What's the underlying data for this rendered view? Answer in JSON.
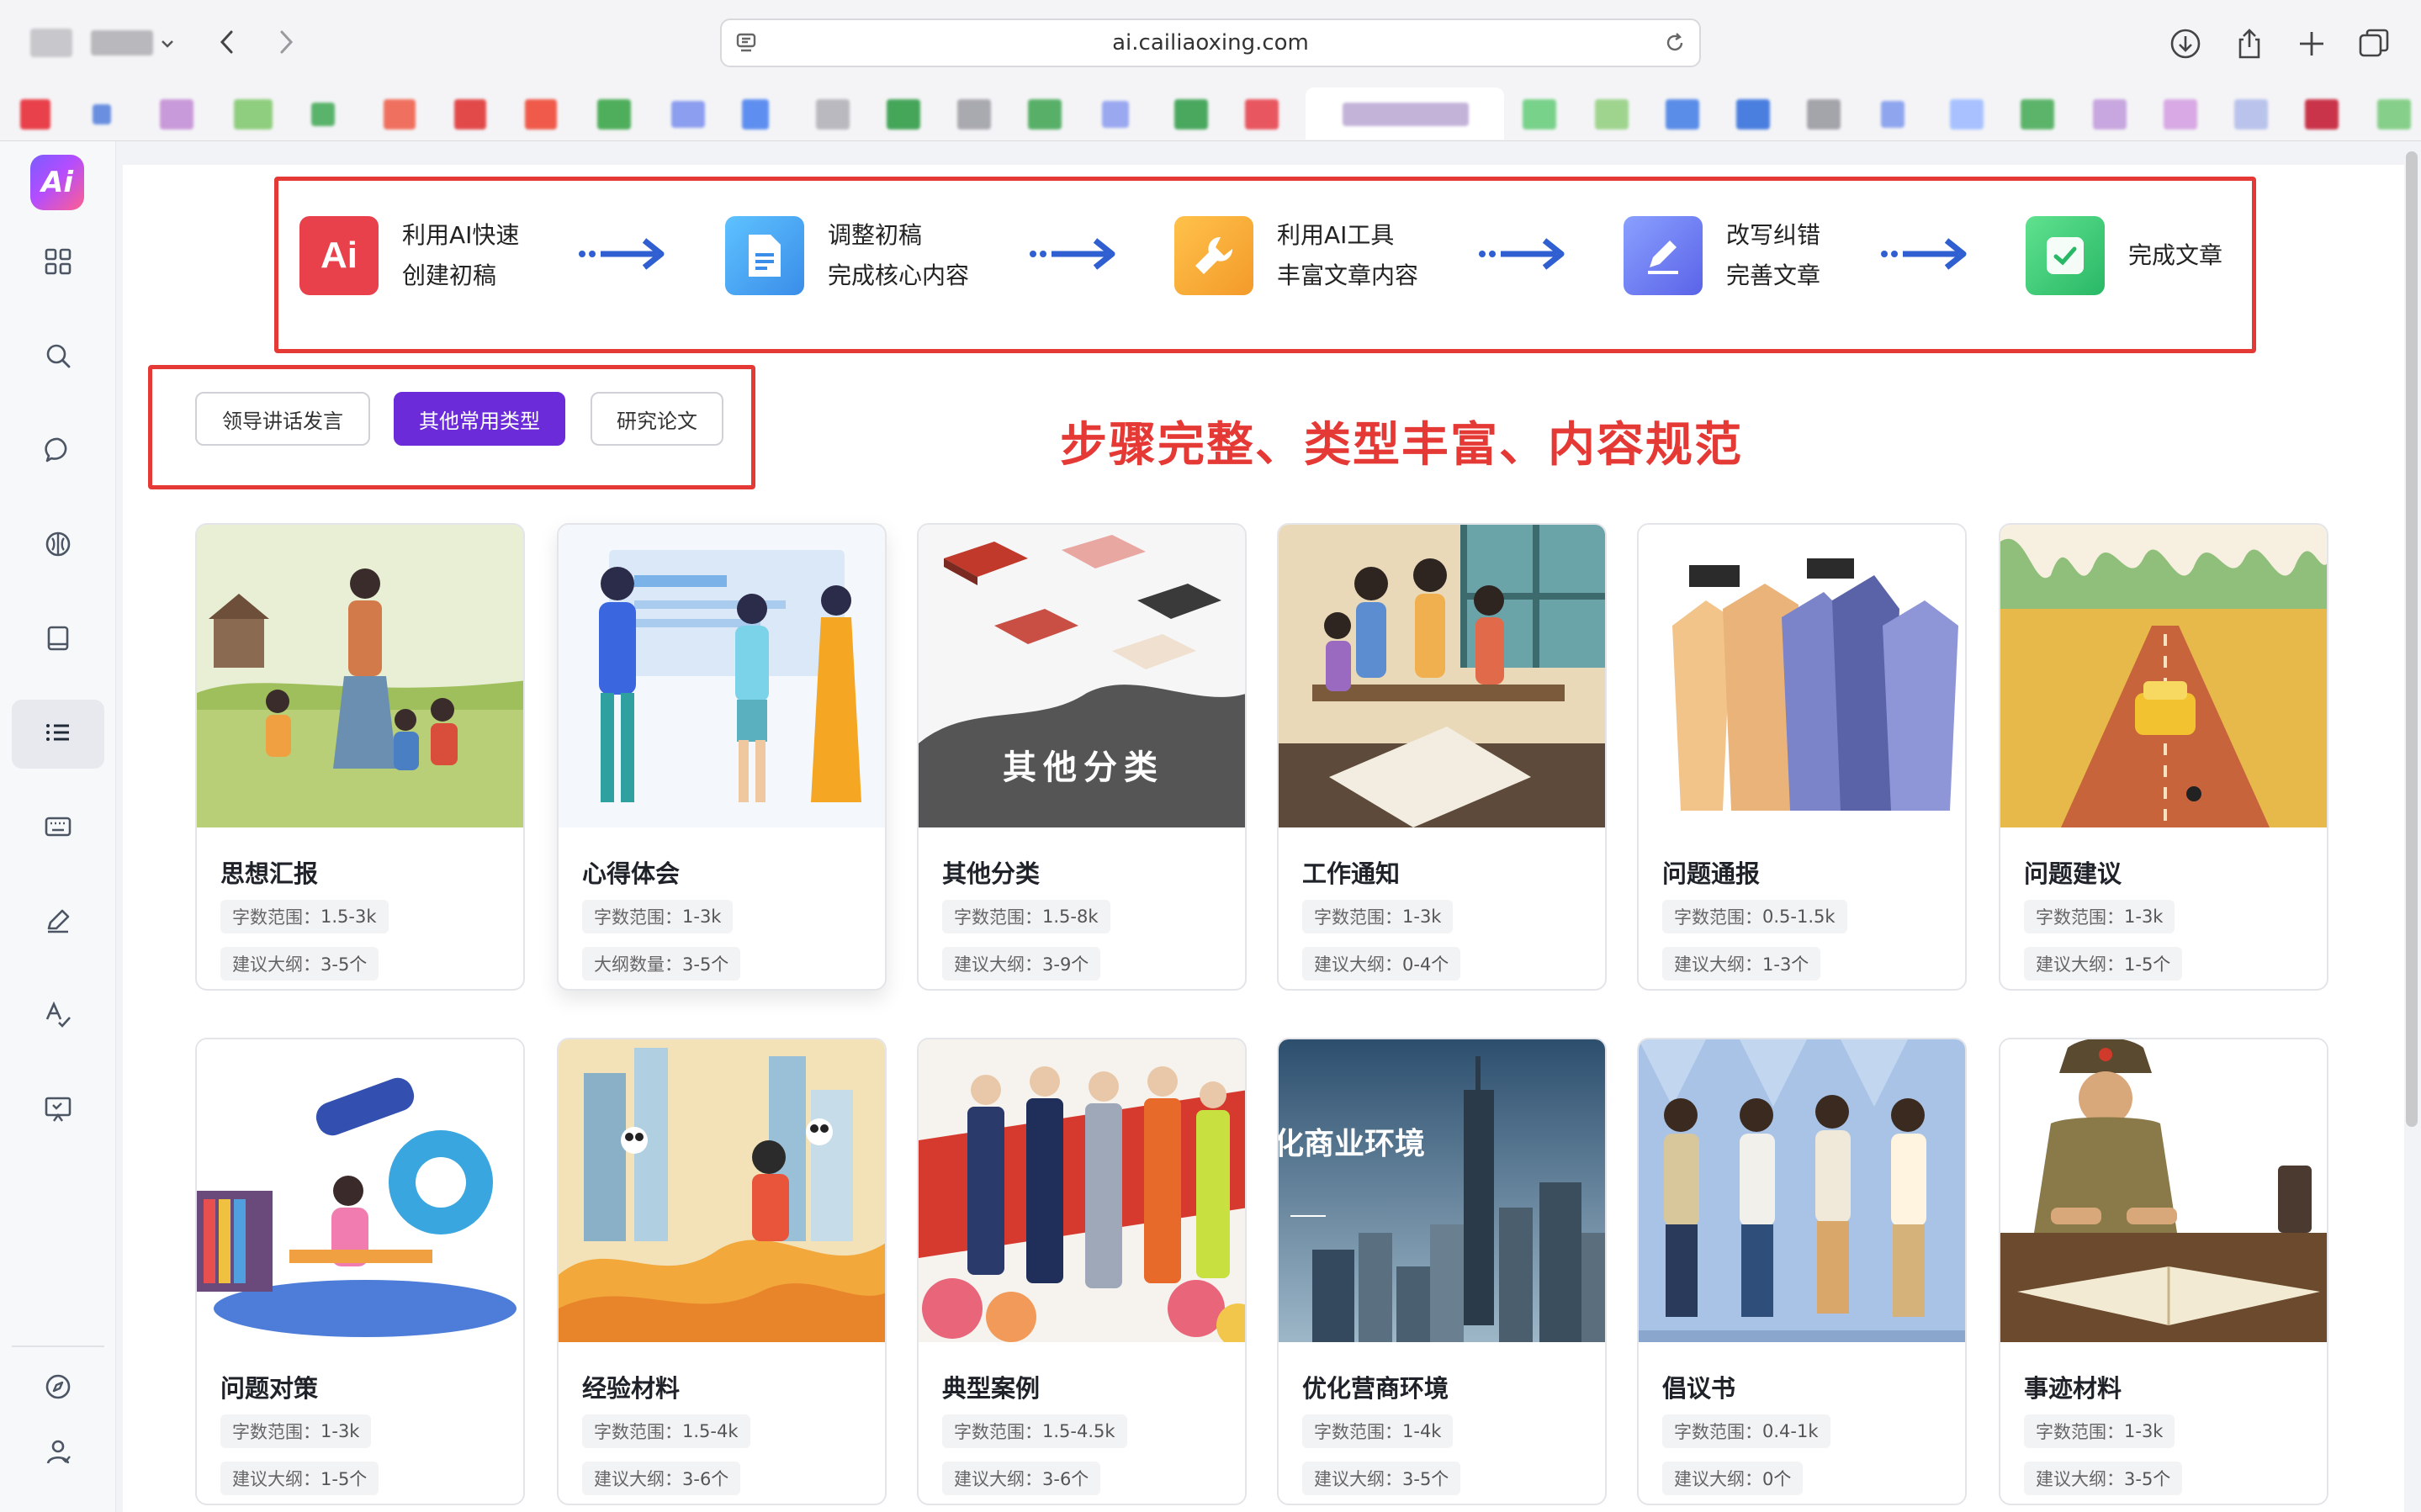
{
  "browser": {
    "url": "ai.cailiaoxing.com"
  },
  "steps": [
    {
      "line1": "利用AI快速",
      "line2": "创建初稿",
      "icon": "ai-badge-icon",
      "color": "#e8414b"
    },
    {
      "line1": "调整初稿",
      "line2": "完成核心内容",
      "icon": "document-icon",
      "color": "#4aa8f0"
    },
    {
      "line1": "利用AI工具",
      "line2": "丰富文章内容",
      "icon": "wrench-icon",
      "color": "#f6a634"
    },
    {
      "line1": "改写纠错",
      "line2": "完善文章",
      "icon": "pen-icon",
      "color": "#6b7ff2"
    },
    {
      "line1": "完成文章",
      "line2": "",
      "icon": "check-icon",
      "color": "#3ecf7a"
    }
  ],
  "filters": [
    {
      "label": "领导讲话发言",
      "active": false
    },
    {
      "label": "其他常用类型",
      "active": true
    },
    {
      "label": "研究论文",
      "active": false
    }
  ],
  "slogan": "步骤完整、类型丰富、内容规范",
  "cards": [
    {
      "title": "思想汇报",
      "tag1_key": "字数范围：",
      "tag1_val": "1.5-3k",
      "tag2_key": "建议大纲：",
      "tag2_val": "3-5个"
    },
    {
      "title": "心得体会",
      "tag1_key": "字数范围：",
      "tag1_val": "1-3k",
      "tag2_key": "大纲数量：",
      "tag2_val": "3-5个"
    },
    {
      "title": "其他分类",
      "tag1_key": "字数范围：",
      "tag1_val": "1.5-8k",
      "tag2_key": "建议大纲：",
      "tag2_val": "3-9个",
      "img_text": "其他分类"
    },
    {
      "title": "工作通知",
      "tag1_key": "字数范围：",
      "tag1_val": "1-3k",
      "tag2_key": "建议大纲：",
      "tag2_val": "0-4个"
    },
    {
      "title": "问题通报",
      "tag1_key": "字数范围：",
      "tag1_val": "0.5-1.5k",
      "tag2_key": "建议大纲：",
      "tag2_val": "1-3个"
    },
    {
      "title": "问题建议",
      "tag1_key": "字数范围：",
      "tag1_val": "1-3k",
      "tag2_key": "建议大纲：",
      "tag2_val": "1-5个"
    },
    {
      "title": "问题对策",
      "tag1_key": "字数范围：",
      "tag1_val": "1-3k",
      "tag2_key": "建议大纲：",
      "tag2_val": "1-5个"
    },
    {
      "title": "经验材料",
      "tag1_key": "字数范围：",
      "tag1_val": "1.5-4k",
      "tag2_key": "建议大纲：",
      "tag2_val": "3-6个"
    },
    {
      "title": "典型案例",
      "tag1_key": "字数范围：",
      "tag1_val": "1.5-4.5k",
      "tag2_key": "建议大纲：",
      "tag2_val": "3-6个"
    },
    {
      "title": "优化营商环境",
      "tag1_key": "字数范围：",
      "tag1_val": "1-4k",
      "tag2_key": "建议大纲：",
      "tag2_val": "3-5个",
      "img_text": "化商业环境"
    },
    {
      "title": "倡议书",
      "tag1_key": "字数范围：",
      "tag1_val": "0.4-1k",
      "tag2_key": "建议大纲：",
      "tag2_val": "0个"
    },
    {
      "title": "事迹材料",
      "tag1_key": "字数范围：",
      "tag1_val": "1-3k",
      "tag2_key": "建议大纲：",
      "tag2_val": "3-5个"
    }
  ],
  "sidebar": {
    "logo": "Ai",
    "items": [
      "grid-icon",
      "search-icon",
      "chat-icon",
      "brain-icon",
      "book-icon",
      "list-icon",
      "keyboard-icon",
      "pen-icon",
      "translate-icon",
      "presentation-icon"
    ],
    "bottom": [
      "compass-icon",
      "user-icon"
    ]
  }
}
